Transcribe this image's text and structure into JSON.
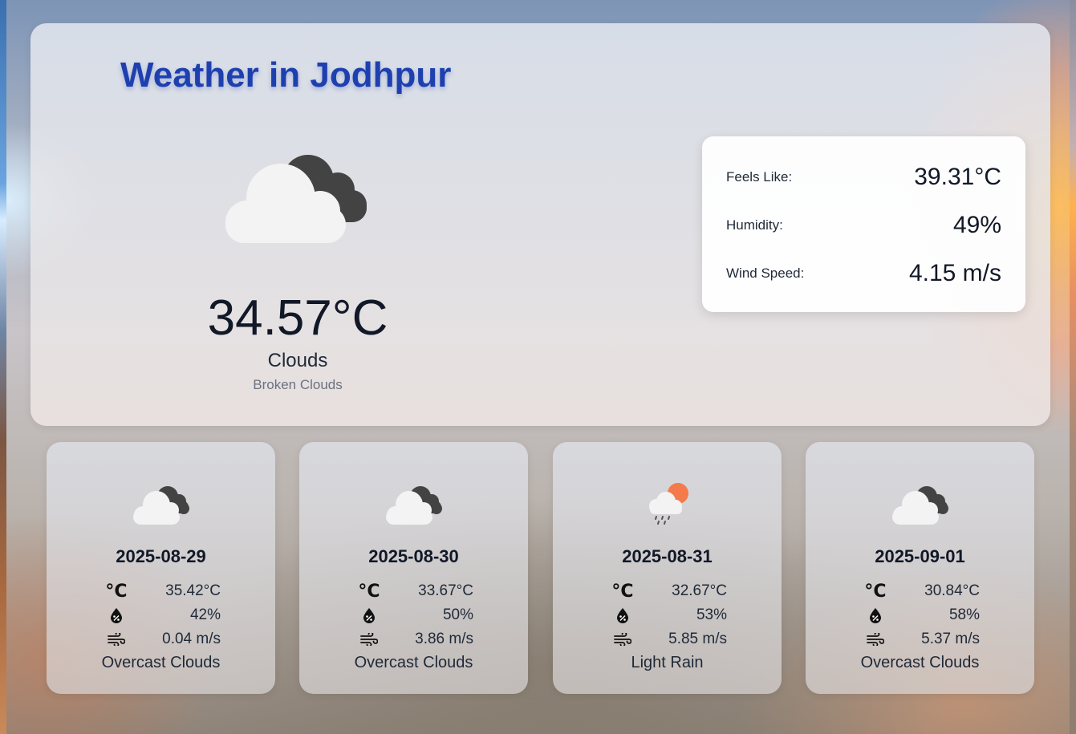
{
  "city_title": "Weather in Jodhpur",
  "current": {
    "icon": "broken-clouds-icon",
    "temperature": "34.57°C",
    "main": "Clouds",
    "description": "Broken Clouds"
  },
  "details": {
    "feels_like_label": "Feels Like:",
    "feels_like_value": "39.31°C",
    "humidity_label": "Humidity:",
    "humidity_value": "49%",
    "wind_label": "Wind Speed:",
    "wind_value": "4.15 m/s"
  },
  "forecast": [
    {
      "icon": "broken-clouds-icon",
      "date": "2025-08-29",
      "temp": "35.42°C",
      "humidity": "42%",
      "wind": "0.04 m/s",
      "description": "Overcast Clouds"
    },
    {
      "icon": "broken-clouds-icon",
      "date": "2025-08-30",
      "temp": "33.67°C",
      "humidity": "50%",
      "wind": "3.86 m/s",
      "description": "Overcast Clouds"
    },
    {
      "icon": "light-rain-sun-icon",
      "date": "2025-08-31",
      "temp": "32.67°C",
      "humidity": "53%",
      "wind": "5.85 m/s",
      "description": "Light Rain"
    },
    {
      "icon": "broken-clouds-icon",
      "date": "2025-09-01",
      "temp": "30.84°C",
      "humidity": "58%",
      "wind": "5.37 m/s",
      "description": "Overcast Clouds"
    }
  ],
  "icons": {
    "temperature": "celsius-icon",
    "humidity": "humidity-drop-icon",
    "wind": "wind-icon"
  },
  "colors": {
    "title": "#1e40af",
    "cloud_light": "#f3f3f3",
    "cloud_dark": "#434343",
    "sun": "#f47a4a"
  }
}
